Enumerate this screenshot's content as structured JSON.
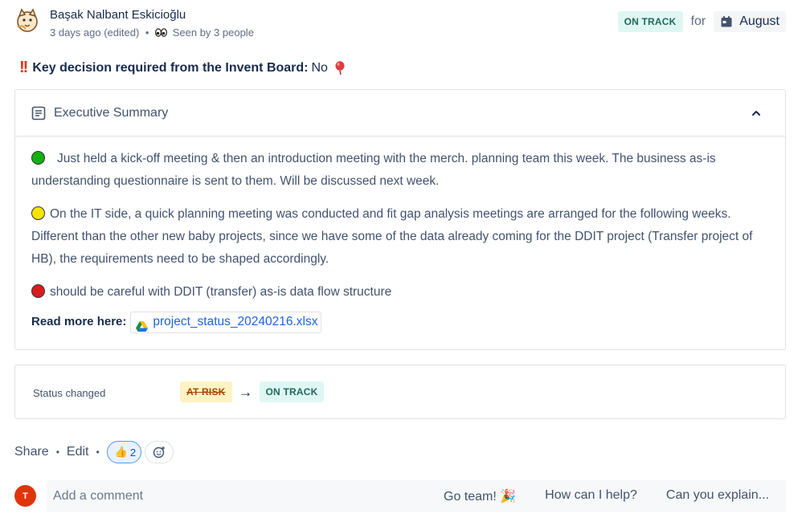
{
  "header": {
    "author": "Başak Nalbant Eskicioğlu",
    "time": "3 days ago (edited)",
    "dot": "•",
    "seen": "Seen by 3 people",
    "status": "ON TRACK",
    "for_text": "for",
    "month": "August",
    "avatar_icon": "cat-avatar-icon",
    "calendar_icon": "calendar-icon"
  },
  "decision": {
    "bang": "!!",
    "label": "Key decision required from the Invent Board:",
    "value": "No"
  },
  "summary": {
    "title": "Executive Summary",
    "items": [
      {
        "color": "green",
        "text": "Just held a kick-off meeting & then an introduction meeting with the merch. planning team this week. The business as-is understanding questionnaire is sent to them. Will be discussed next week."
      },
      {
        "color": "yellow",
        "text": "On the IT side, a quick planning meeting was conducted and fit gap analysis meetings are arranged for the following weeks. Different than the other new baby projects, since we have some of the data already coming for the DDIT project (Transfer project of HB), the requirements need to be shaped accordingly."
      },
      {
        "color": "red",
        "text": "should be careful with DDIT (transfer) as-is data flow structure"
      }
    ],
    "read_more_label": "Read more here:",
    "file_name": "project_status_20240216.xlsx"
  },
  "status_change": {
    "label": "Status changed",
    "from": "AT RISK",
    "arrow": "→",
    "to": "ON TRACK"
  },
  "actions": {
    "share": "Share",
    "edit": "Edit",
    "sep": "•",
    "reaction_count": "2",
    "reaction_emoji": "👍"
  },
  "comment": {
    "avatar_initial": "T",
    "placeholder": "Add a comment",
    "quick_replies": [
      "Go team! 🎉",
      "How can I help?",
      "Can you explain..."
    ]
  },
  "colors": {
    "on_track_bg": "#dff7f3",
    "at_risk_bg": "#fff3c4",
    "link": "#1d64d8"
  }
}
